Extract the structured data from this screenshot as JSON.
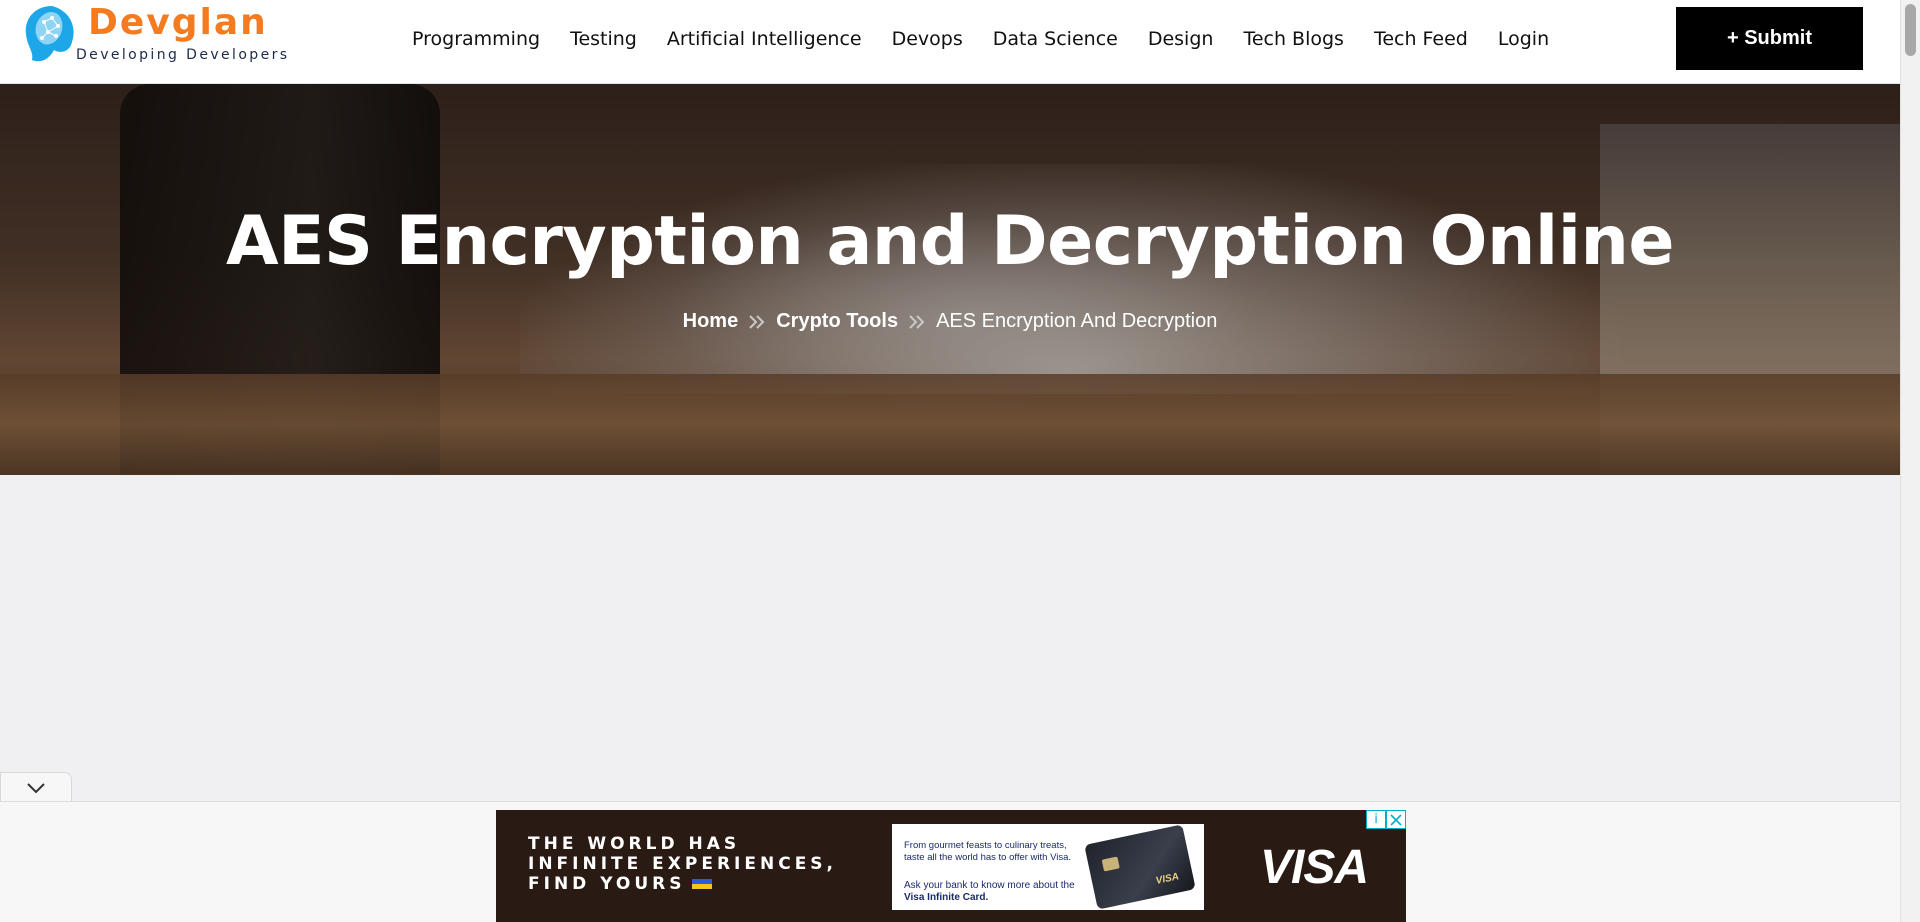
{
  "logo": {
    "title": "Devglan",
    "tagline": "Developing Developers"
  },
  "nav": {
    "items": [
      {
        "label": "Programming"
      },
      {
        "label": "Testing"
      },
      {
        "label": "Artificial Intelligence"
      },
      {
        "label": "Devops"
      },
      {
        "label": "Data Science"
      },
      {
        "label": "Design"
      },
      {
        "label": "Tech Blogs"
      },
      {
        "label": "Tech Feed"
      },
      {
        "label": "Login"
      }
    ],
    "submit_label": "+ Submit"
  },
  "hero": {
    "title": "AES Encryption and Decryption Online",
    "breadcrumb": [
      {
        "label": "Home"
      },
      {
        "label": "Crypto Tools"
      },
      {
        "label": "AES Encryption And Decryption"
      }
    ]
  },
  "ad": {
    "headline_line1": "THE WORLD HAS",
    "headline_line2": "INFINITE EXPERIENCES,",
    "headline_line3": "FIND YOURS",
    "card_text1": "From gourmet feasts to culinary treats, taste all the world has to offer with Visa.",
    "card_text2_prefix": "Ask your bank to know more about the ",
    "card_text2_bold": "Visa Infinite Card.",
    "card_logo": "VISA",
    "brand": "VISA",
    "info_icon": "info-icon",
    "close_icon": "close-icon"
  },
  "colors": {
    "brand_orange": "#f47b20",
    "submit_bg": "#000000",
    "page_bg": "#f0f0f2",
    "ad_accent": "#00aecd"
  }
}
